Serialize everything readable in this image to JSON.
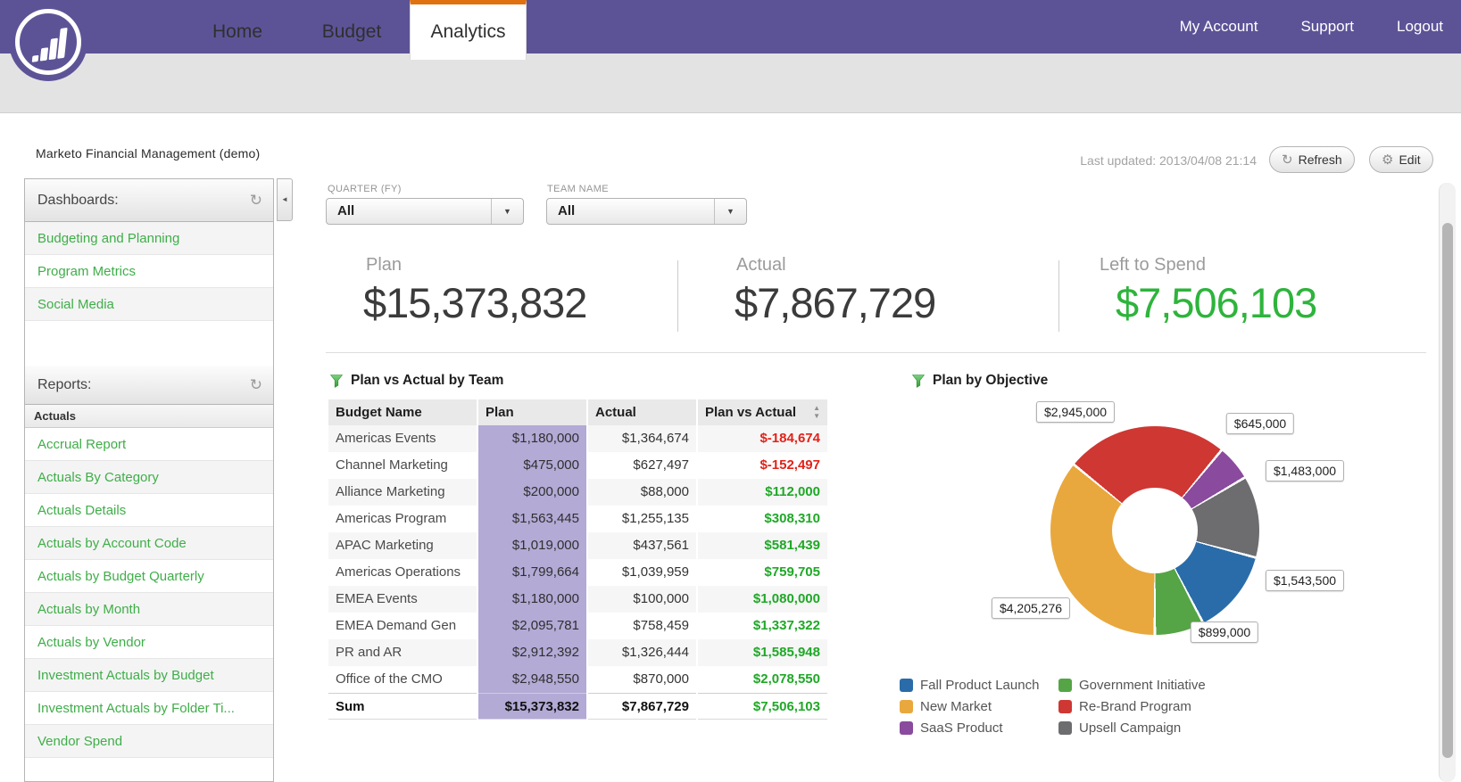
{
  "top_nav": {
    "links": [
      "My Account",
      "Support",
      "Logout"
    ]
  },
  "tabs": [
    "Home",
    "Budget",
    "Analytics"
  ],
  "active_tab": "Analytics",
  "page": {
    "workspace_title": "Marketo Financial Management (demo)",
    "last_updated": "Last updated: 2013/04/08 21:14",
    "refresh_label": "Refresh",
    "edit_label": "Edit"
  },
  "icons": {
    "refresh": "↻",
    "gear": "⚙",
    "collapse_left": "◄",
    "dropdown_arrow": "▼",
    "sort_up": "▲",
    "sort_down": "▼"
  },
  "sidebar": {
    "dashboards": {
      "title": "Dashboards:",
      "items": [
        "Budgeting and Planning",
        "Program Metrics",
        "Social Media"
      ]
    },
    "reports": {
      "title": "Reports:",
      "group": "Actuals",
      "items": [
        "Accrual Report",
        "Actuals By Category",
        "Actuals Details",
        "Actuals by Account Code",
        "Actuals by Budget Quarterly",
        "Actuals by Month",
        "Actuals by Vendor",
        "Investment Actuals by Budget",
        "Investment Actuals by Folder Ti...",
        "Vendor Spend"
      ]
    }
  },
  "filters": {
    "quarter": {
      "label": "QUARTER (FY)",
      "value": "All"
    },
    "team": {
      "label": "TEAM NAME",
      "value": "All"
    }
  },
  "kpis": [
    {
      "label": "Plan",
      "value": "$15,373,832",
      "color": "#3b3b3b"
    },
    {
      "label": "Actual",
      "value": "$7,867,729",
      "color": "#3b3b3b"
    },
    {
      "label": "Left to Spend",
      "value": "$7,506,103",
      "color": "#2eb43c"
    }
  ],
  "table": {
    "title": "Plan vs Actual by Team",
    "columns": [
      "Budget Name",
      "Plan",
      "Actual",
      "Plan vs Actual"
    ],
    "rows": [
      {
        "name": "Americas Events",
        "plan": "$1,180,000",
        "actual": "$1,364,674",
        "diff": "$-184,674",
        "diff_positive": false
      },
      {
        "name": "Channel Marketing",
        "plan": "$475,000",
        "actual": "$627,497",
        "diff": "$-152,497",
        "diff_positive": false
      },
      {
        "name": "Alliance Marketing",
        "plan": "$200,000",
        "actual": "$88,000",
        "diff": "$112,000",
        "diff_positive": true
      },
      {
        "name": "Americas Program",
        "plan": "$1,563,445",
        "actual": "$1,255,135",
        "diff": "$308,310",
        "diff_positive": true
      },
      {
        "name": "APAC Marketing",
        "plan": "$1,019,000",
        "actual": "$437,561",
        "diff": "$581,439",
        "diff_positive": true
      },
      {
        "name": "Americas Operations",
        "plan": "$1,799,664",
        "actual": "$1,039,959",
        "diff": "$759,705",
        "diff_positive": true
      },
      {
        "name": "EMEA Events",
        "plan": "$1,180,000",
        "actual": "$100,000",
        "diff": "$1,080,000",
        "diff_positive": true
      },
      {
        "name": "EMEA Demand Gen",
        "plan": "$2,095,781",
        "actual": "$758,459",
        "diff": "$1,337,322",
        "diff_positive": true
      },
      {
        "name": "PR and AR",
        "plan": "$2,912,392",
        "actual": "$1,326,444",
        "diff": "$1,585,948",
        "diff_positive": true
      },
      {
        "name": "Office of the CMO",
        "plan": "$2,948,550",
        "actual": "$870,000",
        "diff": "$2,078,550",
        "diff_positive": true
      }
    ],
    "sum_row": {
      "name": "Sum",
      "plan": "$15,373,832",
      "actual": "$7,867,729",
      "diff": "$7,506,103",
      "diff_positive": true
    }
  },
  "colors": {
    "positive": "#1fa827",
    "negative": "#e32118",
    "plan_cell": "#b3aad6",
    "link_green": "#3fae49",
    "accent_orange": "#e0710f",
    "header_purple": "#5c5397"
  },
  "chart_data": {
    "type": "pie",
    "title": "Plan by Objective",
    "donut": true,
    "start_angle_deg": 309.2,
    "slices": [
      {
        "name": "Re-Brand Program",
        "value": 2945000,
        "label": "$2,945,000",
        "color": "#cf3733"
      },
      {
        "name": "SaaS Product",
        "value": 645000,
        "label": "$645,000",
        "color": "#8a4a9d"
      },
      {
        "name": "Upsell Campaign",
        "value": 1483000,
        "label": "$1,483,000",
        "color": "#6d6d70"
      },
      {
        "name": "Fall Product Launch",
        "value": 1543500,
        "label": "$1,543,500",
        "color": "#2a6ca9"
      },
      {
        "name": "Government Initiative",
        "value": 899000,
        "label": "$899,000",
        "color": "#55a546"
      },
      {
        "name": "New Market",
        "value": 4205276,
        "label": "$4,205,276",
        "color": "#e9a83d"
      }
    ],
    "legend": {
      "col1": [
        "Fall Product Launch",
        "New Market",
        "SaaS Product"
      ],
      "col2": [
        "Government Initiative",
        "Re-Brand Program",
        "Upsell Campaign"
      ]
    }
  }
}
